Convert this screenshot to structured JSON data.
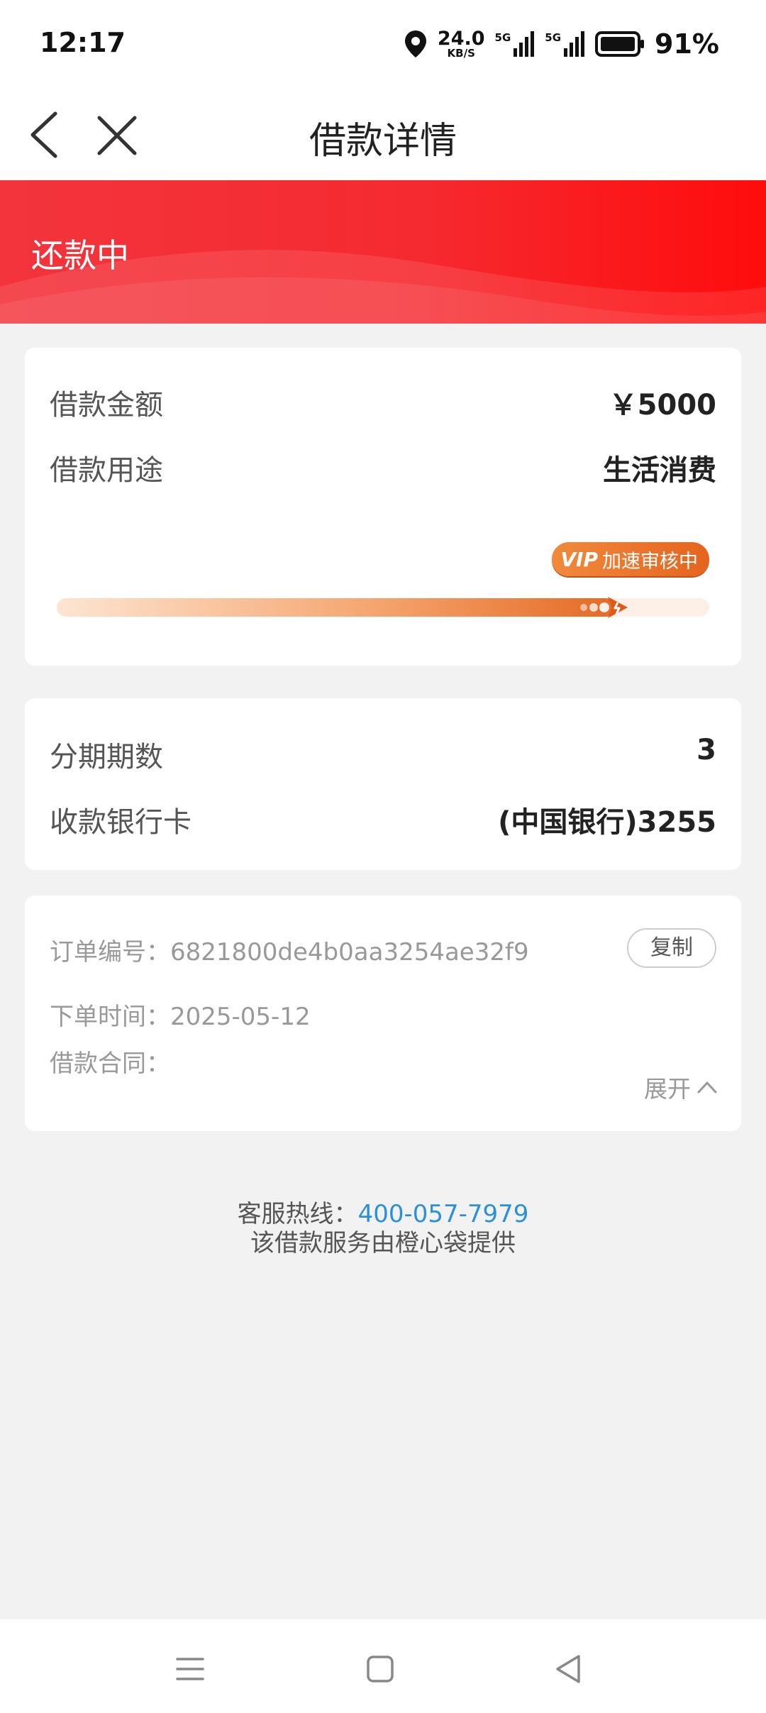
{
  "status_bar": {
    "time": "12:17",
    "net_speed_value": "24.0",
    "net_speed_unit": "KB/S",
    "sim1_tag": "5G",
    "sim2_tag": "5G",
    "battery_percent": "91%"
  },
  "nav": {
    "title": "借款详情",
    "back_icon": "chevron-left-icon",
    "close_icon": "close-icon"
  },
  "banner": {
    "status": "还款中"
  },
  "loan_card": {
    "amount_label": "借款金额",
    "amount_value": "￥5000",
    "purpose_label": "借款用途",
    "purpose_value": "生活消费",
    "vip_mark": "VIP",
    "vip_text": "加速审核中",
    "progress": 0.93
  },
  "repay_card": {
    "installments_label": "分期期数",
    "installments_value": "3",
    "bank_label": "收款银行卡",
    "bank_value": "(中国银行)3255"
  },
  "order_card": {
    "order_no_label": "订单编号：",
    "order_no_value": "6821800de4b0aa3254ae32f9",
    "copy_label": "复制",
    "time_label": "下单时间：",
    "time_value": "2025-05-12",
    "contract_label": "借款合同：",
    "expand_label": "展开"
  },
  "footer": {
    "hotline_label": "客服热线：",
    "hotline_number": "400-057-7979",
    "provider_text": "该借款服务由橙心袋提供"
  },
  "colors": {
    "brand_red": "#f52a30",
    "vip_orange": "#e5641e",
    "link_blue": "#2a8fde"
  }
}
